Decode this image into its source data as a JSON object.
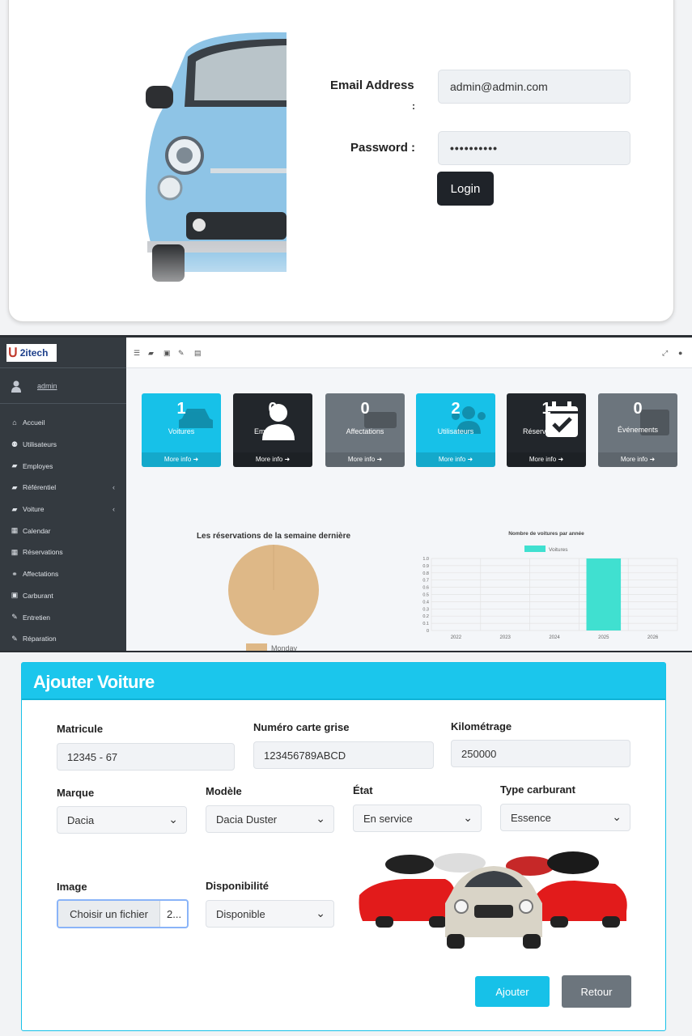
{
  "login": {
    "email_label": "Email Address",
    "email_colon": ":",
    "email_value": "admin@admin.com",
    "password_label": "Password :",
    "password_value": "••••••••••",
    "login_button": "Login"
  },
  "dashboard": {
    "brand": "2itech",
    "user": "admin",
    "nav": [
      {
        "label": "Accueil",
        "icon": "home-icon"
      },
      {
        "label": "Utilisateurs",
        "icon": "users-icon"
      },
      {
        "label": "Employes",
        "icon": "briefcase-icon"
      },
      {
        "label": "Référentiel",
        "icon": "car-icon",
        "chevron": true
      },
      {
        "label": "Voiture",
        "icon": "car-icon",
        "chevron": true
      },
      {
        "label": "Calendar",
        "icon": "calendar-icon"
      },
      {
        "label": "Réservations",
        "icon": "calendar-check-icon"
      },
      {
        "label": "Affectations",
        "icon": "handshake-icon"
      },
      {
        "label": "Carburant",
        "icon": "gas-pump-icon"
      },
      {
        "label": "Entretien",
        "icon": "wrench-icon"
      },
      {
        "label": "Réparation",
        "icon": "wrench-icon"
      }
    ],
    "boxes": [
      {
        "number": "1",
        "label": "Voitures",
        "more": "More info",
        "color": "#17c1e8",
        "icon": "car-icon"
      },
      {
        "number": "0",
        "label": "Emp",
        "more": "More info",
        "color": "#22262b",
        "icon": "user-icon"
      },
      {
        "number": "0",
        "label": "Affectations",
        "more": "More info",
        "color": "#6c757d",
        "icon": "handshake-icon"
      },
      {
        "number": "2",
        "label": "Utilisateurs",
        "more": "More info",
        "color": "#17c1e8",
        "icon": "users-icon"
      },
      {
        "number": "1",
        "label": "Réserv",
        "more": "More info",
        "color": "#22262b",
        "icon": "calendar-check-icon"
      },
      {
        "number": "0",
        "label": "Événements",
        "more": "More info",
        "color": "#6c757d",
        "icon": "calendar-icon"
      }
    ]
  },
  "chart_data": [
    {
      "type": "pie",
      "title": "Les réservations de la semaine dernière",
      "labels": [
        "Monday"
      ],
      "values": [
        1
      ],
      "colors": [
        "#deb887"
      ],
      "legend": "bottom"
    },
    {
      "type": "bar",
      "title": "Nombre de voitures par année",
      "categories": [
        "2022",
        "2023",
        "2024",
        "2025",
        "2026"
      ],
      "series": [
        {
          "name": "Voitures",
          "values": [
            0,
            0,
            0,
            1,
            0
          ],
          "color": "#40e0d0"
        }
      ],
      "ylim": [
        0,
        1.0
      ],
      "yticks": [
        "0",
        "0.1",
        "0.2",
        "0.3",
        "0.4",
        "0.5",
        "0.6",
        "0.7",
        "0.8",
        "0.9",
        "1.0"
      ],
      "legend": "top",
      "grid": true
    }
  ],
  "form": {
    "title": "Ajouter Voiture",
    "matricule_label": "Matricule",
    "matricule_value": "12345 - 67",
    "carte_label": "Numéro carte grise",
    "carte_value": "123456789ABCD",
    "km_label": "Kilométrage",
    "km_value": "250000",
    "marque_label": "Marque",
    "marque_value": "Dacia",
    "modele_label": "Modèle",
    "modele_value": "Dacia Duster",
    "etat_label": "État",
    "etat_value": "En service",
    "carburant_label": "Type carburant",
    "carburant_value": "Essence",
    "image_label": "Image",
    "file_button": "Choisir un fichier",
    "file_name": "2...",
    "dispo_label": "Disponibilité",
    "dispo_value": "Disponible",
    "submit": "Ajouter",
    "back": "Retour"
  }
}
